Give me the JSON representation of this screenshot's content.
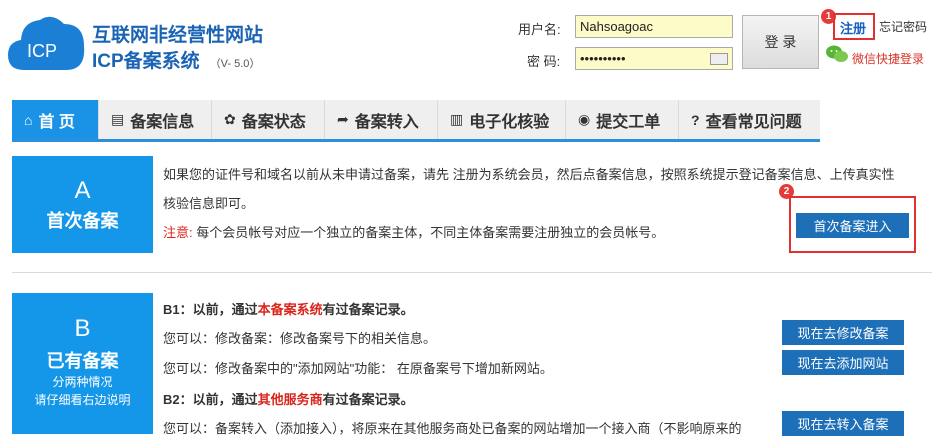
{
  "header": {
    "logo_text": "ICP",
    "title": "互联网非经营性网站",
    "subtitle": "ICP备案系统",
    "version": "（V- 5.0）"
  },
  "login": {
    "username_label": "用户名:",
    "username_value": "Nahsoagoac",
    "password_label": "密 码:",
    "password_value": "••••••••••",
    "login_button": "登 录",
    "register_link": "注册",
    "forgot_link": "忘记密码",
    "wechat_login": "微信快捷登录",
    "badge_1": "1",
    "badge_2": "2"
  },
  "nav": {
    "items": [
      {
        "label": "首 页",
        "icon": "home-icon",
        "glyph": "⌂"
      },
      {
        "label": "备案信息",
        "icon": "document-icon",
        "glyph": "▤"
      },
      {
        "label": "备案状态",
        "icon": "status-icon",
        "glyph": "✿"
      },
      {
        "label": "备案转入",
        "icon": "transfer-arrow-icon",
        "glyph": "➦"
      },
      {
        "label": "电子化核验",
        "icon": "verify-icon",
        "glyph": "▥"
      },
      {
        "label": "提交工单",
        "icon": "user-icon",
        "glyph": "◉"
      },
      {
        "label": "查看常见问题",
        "icon": "help-icon",
        "glyph": "?"
      }
    ]
  },
  "section_a": {
    "letter": "A",
    "title": "首次备案",
    "line1": "如果您的证件号和域名以前从未申请过备案，请先 注册为系统会员，然后点备案信息，按照系统提示登记备案信息、上传真实性",
    "line2": "核验信息即可。",
    "note_label": "注意:",
    "note_text": " 每个会员帐号对应一个独立的备案主体，不同主体备案需要注册独立的会员帐号。",
    "button": "首次备案进入"
  },
  "section_b": {
    "letter": "B",
    "title": "已有备案",
    "note1": "分两种情况",
    "note2": "请仔细看右边说明",
    "b1_prefix": "B1：以前，通过",
    "b1_highlight": "本备案系统",
    "b1_suffix": "有过备案记录。",
    "b1_line1": "您可以：修改备案：修改备案号下的相关信息。",
    "b1_line2": "您可以：修改备案中的\"添加网站\"功能： 在原备案号下增加新网站。",
    "b2_prefix": "B2：以前，通过",
    "b2_highlight": "其他服务商",
    "b2_suffix": "有过备案记录。",
    "b2_line1": "您可以：备案转入（添加接入），将原来在其他服务商处已备案的网站增加一个接入商（不影响原来的",
    "btn_modify": "现在去修改备案",
    "btn_add_site": "现在去添加网站",
    "btn_transfer": "现在去转入备案"
  },
  "colors": {
    "primary_blue": "#1496e9",
    "button_blue": "#1d6fb8",
    "highlight_red": "#e03030"
  }
}
